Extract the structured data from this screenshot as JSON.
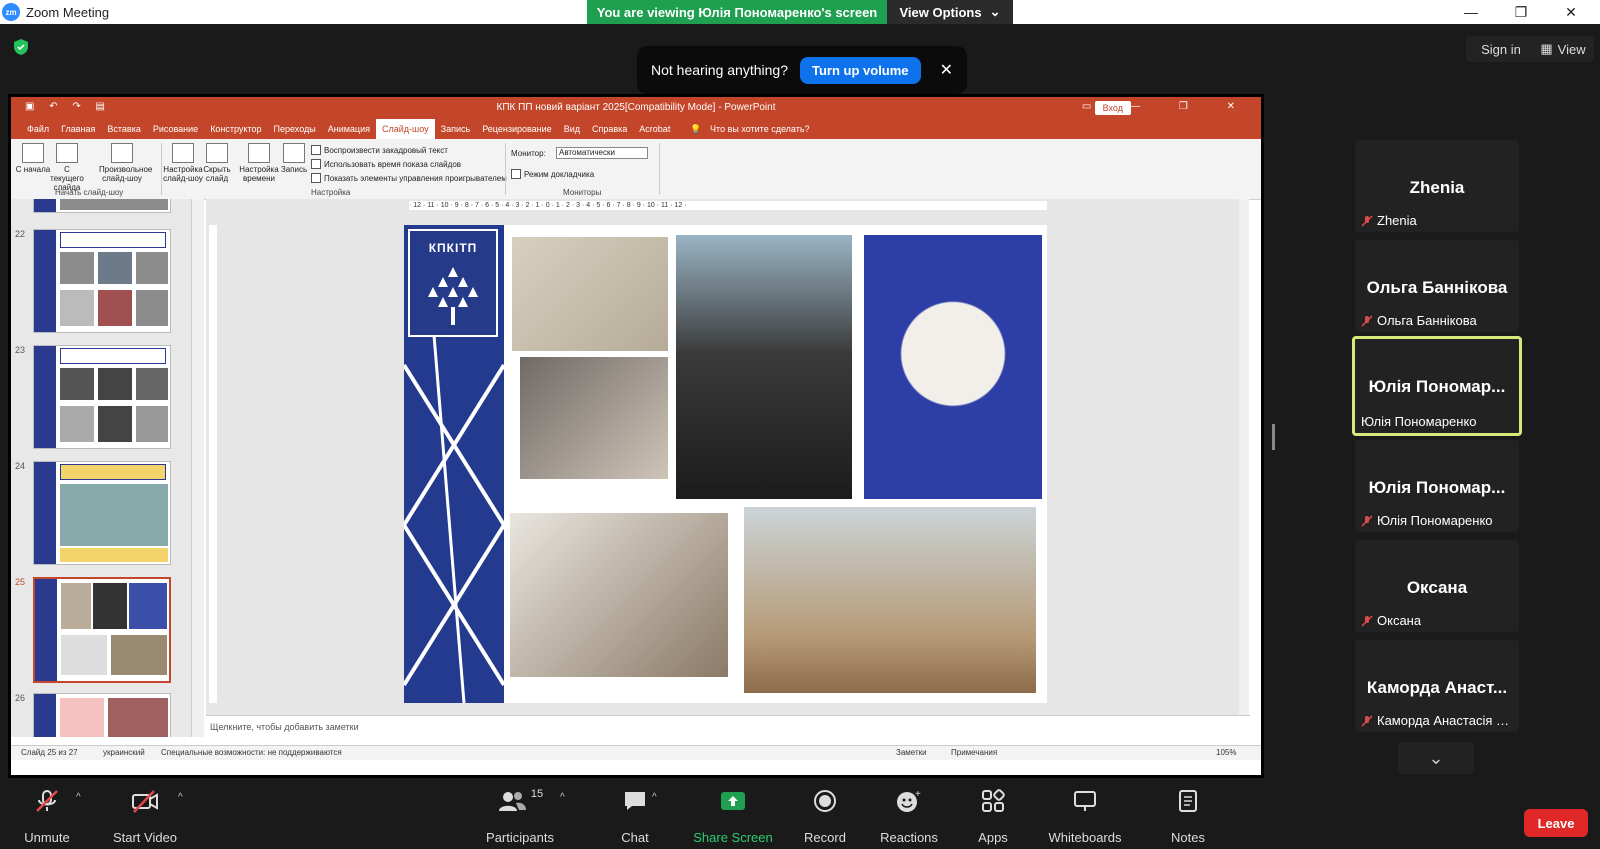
{
  "window": {
    "title": "Zoom Meeting",
    "logo": "zm"
  },
  "banner": {
    "viewing": "You are viewing Юлія Пономаренко's screen",
    "view_options": "View Options"
  },
  "top_right": {
    "sign_in": "Sign in",
    "view": "View"
  },
  "toast": {
    "message": "Not hearing anything?",
    "action": "Turn up volume"
  },
  "powerpoint": {
    "title": "КПК ПП новий варіант 2025[Compatibility Mode] - PowerPoint",
    "login": "Вход",
    "tabs": [
      "Файл",
      "Главная",
      "Вставка",
      "Рисование",
      "Конструктор",
      "Переходы",
      "Анимация",
      "Слайд-шоу",
      "Запись",
      "Рецензирование",
      "Вид",
      "Справка",
      "Acrobat"
    ],
    "active_tab": "Слайд-шоу",
    "tell_me": "Что вы хотите сделать?",
    "ribbon": {
      "from_start": "С начала",
      "from_current": "С текущего слайда",
      "custom": "Произвольное слайд-шоу",
      "setup": "Настройка слайд-шоу",
      "hide": "Скрыть слайд",
      "rehearse": "Настройка времени",
      "record": "Запись",
      "check1": "Воспроизвести закадровый текст",
      "check2": "Использовать время показа слайдов",
      "check3": "Показать элементы управления проигрывателем",
      "monitor_label": "Монитор:",
      "monitor_value": "Автоматически",
      "presenter": "Режим докладчика",
      "group_start": "Начать слайд-шоу",
      "group_setup": "Настройка",
      "group_monitors": "Мониторы"
    },
    "thumb_numbers": [
      "22",
      "23",
      "24",
      "25",
      "26"
    ],
    "slide_logo": "КПКІТП",
    "notes_placeholder": "Щелкните, чтобы добавить заметки",
    "status": {
      "slide": "Слайд 25 из 27",
      "lang": "украинский",
      "access": "Специальные возможности: не поддерживаются",
      "notes": "Заметки",
      "comments": "Примечания",
      "zoom": "105%"
    }
  },
  "participants_panel": [
    {
      "display": "Zhenia",
      "name": "Zhenia",
      "muted": true
    },
    {
      "display": "Ольга Баннікова",
      "name": "Ольга Баннікова",
      "muted": true
    },
    {
      "display": "Юлія Пономар...",
      "name": "Юлія Пономаренко",
      "muted": false,
      "active": true
    },
    {
      "display": "Юлія Пономар...",
      "name": "Юлія Пономаренко",
      "muted": true
    },
    {
      "display": "Оксана",
      "name": "Оксана",
      "muted": true
    },
    {
      "display": "Каморда Анаст...",
      "name": "Каморда Анастасія Се...",
      "muted": true
    }
  ],
  "toolbar": {
    "unmute": "Unmute",
    "start_video": "Start Video",
    "participants": "Participants",
    "participant_count": "15",
    "chat": "Chat",
    "share_screen": "Share Screen",
    "record": "Record",
    "reactions": "Reactions",
    "apps": "Apps",
    "whiteboards": "Whiteboards",
    "notes": "Notes",
    "leave": "Leave"
  },
  "colors": {
    "share_green": "#1ea050",
    "zoom_blue": "#0e72ed",
    "ppt_orange": "#c4462a",
    "leave_red": "#e02828",
    "active_speaker": "#d8e87a"
  }
}
